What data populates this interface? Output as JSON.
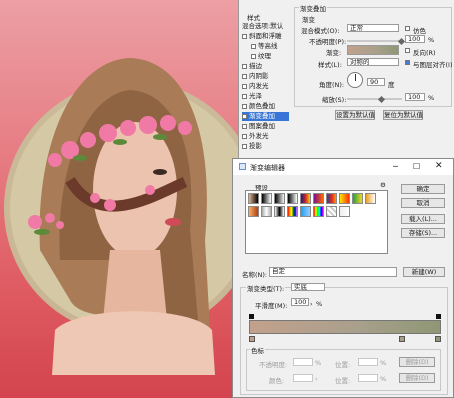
{
  "colors": {
    "gradient_start": "#c2a18c",
    "gradient_end": "#8f9775",
    "panel": "#f0f0f0",
    "selection": "#3875d7"
  },
  "layer_style": {
    "header": "样式",
    "items": [
      "混合选项:默认",
      "斜面和浮雕",
      "等高线",
      "纹理",
      "描边",
      "内阴影",
      "内发光",
      "光泽",
      "颜色叠加",
      "渐变叠加",
      "图案叠加",
      "外发光",
      "投影"
    ],
    "group_title": "渐变叠加",
    "sub_title": "渐变",
    "blend_label": "混合模式(O):",
    "blend_value": "正常",
    "dither": "仿色",
    "opacity_label": "不透明度(P):",
    "opacity_value": "100",
    "pct": "%",
    "gradient_label": "渐变:",
    "reverse": "反向(R)",
    "style_label": "样式(L):",
    "style_value": "对称的",
    "align": "与图层对齐(I)",
    "angle_label": "角度(N):",
    "angle_value": "90",
    "angle_unit": "度",
    "scale_label": "缩放(S):",
    "scale_value": "100",
    "btn_default": "设置为默认值",
    "btn_reset": "复位为默认值"
  },
  "gradient_editor": {
    "title": "渐变编辑器",
    "presets_label": "预设",
    "gear": "⚙",
    "ok": "确定",
    "cancel": "取消",
    "load": "载入(L)...",
    "save": "存储(S)...",
    "name_label": "名称(N):",
    "name_value": "自定",
    "new_btn": "新建(W)",
    "type_label": "渐变类型(T):",
    "type_value": "实底",
    "smooth_label": "平滑度(M):",
    "smooth_value": "100",
    "pct": "%",
    "stops_label": "色标",
    "opacity_label": "不透明度:",
    "location_label": "位置:",
    "delete": "删除(D)",
    "color_label": "颜色:"
  }
}
